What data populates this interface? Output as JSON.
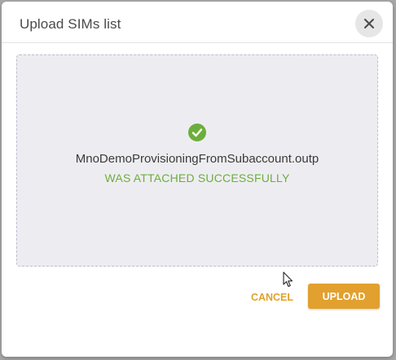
{
  "dialog": {
    "title": "Upload SIMs list",
    "close_icon": "close-icon"
  },
  "dropzone": {
    "status_icon": "check-circle-icon",
    "file_name": "MnoDemoProvisioningFromSubaccount.outp",
    "status_text": "WAS ATTACHED SUCCESSFULLY"
  },
  "actions": {
    "cancel_label": "CANCEL",
    "upload_label": "UPLOAD"
  },
  "colors": {
    "accent": "#e2a02e",
    "success": "#6cae3c",
    "dropzone_bg": "#ededf1"
  }
}
